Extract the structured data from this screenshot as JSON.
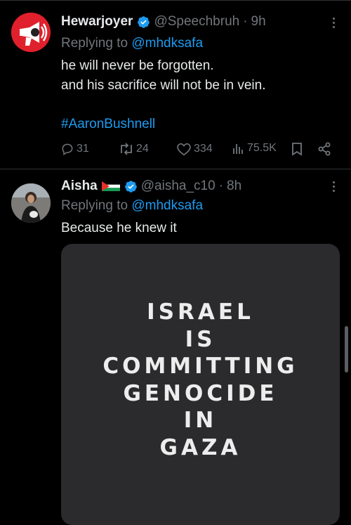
{
  "tweets": [
    {
      "display_name": "Hewarjoyer",
      "handle": "@Speechbruh",
      "time": "9h",
      "replying_prefix": "Replying to",
      "replying_to": "@mhdksafa",
      "body_lines": [
        "he will never be forgotten.",
        "and his sacrifice will not be in vein."
      ],
      "hashtag": "#AaronBushnell",
      "metrics": {
        "replies": "31",
        "reposts": "24",
        "likes": "334",
        "views": "75.5K"
      },
      "avatar_color": "#e0202c"
    },
    {
      "display_name": "Aisha",
      "flag": "palestine-flag",
      "handle": "@aisha_c10",
      "time": "8h",
      "replying_prefix": "Replying to",
      "replying_to": "@mhdksafa",
      "body_lines": [
        "Because he knew it"
      ],
      "media_text_lines": [
        "ISRAEL",
        "IS",
        "COMMITTING",
        "GENOCIDE",
        "IN",
        "GAZA"
      ]
    }
  ],
  "colors": {
    "accent": "#1d9bf0",
    "muted": "#71767b",
    "background": "#000000"
  }
}
